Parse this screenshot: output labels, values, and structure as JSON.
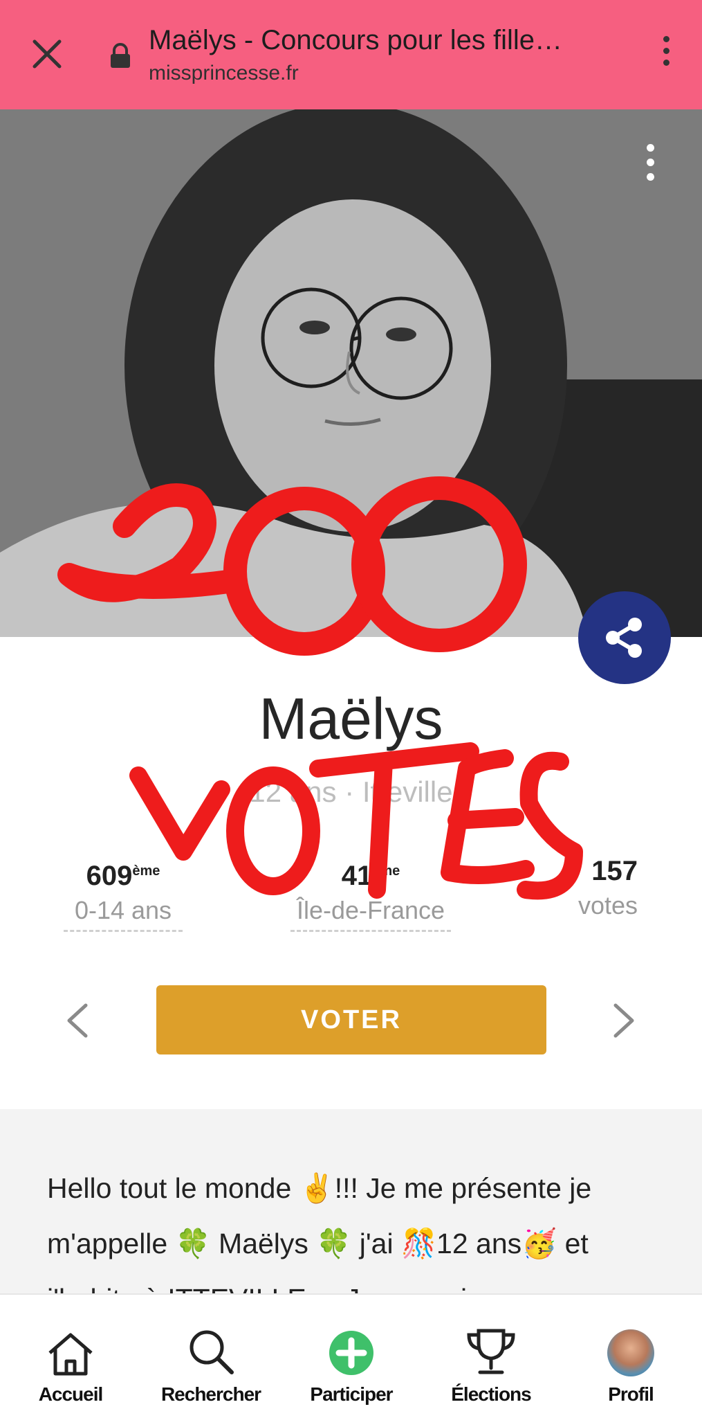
{
  "browser": {
    "title": "Maëlys - Concours pour les fille…",
    "url": "missprincesse.fr"
  },
  "profile": {
    "name": "Maëlys",
    "subtitle": "12 ans · Itteville",
    "stats": [
      {
        "value": "609",
        "suffix": "ème",
        "label": "0-14 ans"
      },
      {
        "value": "41",
        "suffix": "ème",
        "label": "Île-de-France"
      },
      {
        "value": "157",
        "suffix": "",
        "label": "votes"
      }
    ],
    "vote_button": "VOTER"
  },
  "description": {
    "text": "Hello tout le monde ✌️!!! Je me présente je m'appelle 🍀 Maëlys 🍀 j'ai 🎊12 ans🥳 et j'habite à ITTEVILLE ... Je me suis"
  },
  "overlay": {
    "handwriting_top": "200",
    "handwriting_bottom": "VOTES",
    "color": "#ee1c1c"
  },
  "bottom_nav": {
    "items": [
      {
        "label": "Accueil",
        "icon": "home-icon"
      },
      {
        "label": "Rechercher",
        "icon": "search-icon"
      },
      {
        "label": "Participer",
        "icon": "plus-circle-icon"
      },
      {
        "label": "Élections",
        "icon": "trophy-icon"
      },
      {
        "label": "Profil",
        "icon": "avatar"
      }
    ]
  },
  "colors": {
    "topbar": "#f65f80",
    "share": "#243384",
    "vote": "#dd9f2a",
    "participate": "#3fc06a"
  }
}
